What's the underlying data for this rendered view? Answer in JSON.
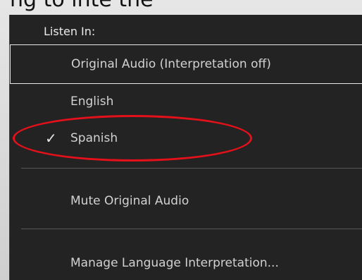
{
  "background_crop_text": "ng  to inte    the",
  "menu": {
    "header": "Listen In:",
    "items": [
      {
        "label": "Original Audio (Interpretation off)",
        "selected": false
      },
      {
        "label": "English",
        "selected": false
      },
      {
        "label": "Spanish",
        "selected": true
      }
    ],
    "checkmark": "✓",
    "mute_label": "Mute Original Audio",
    "manage_label": "Manage Language Interpretation..."
  },
  "colors": {
    "menu_bg": "#232323",
    "highlight": "#e4101a"
  }
}
